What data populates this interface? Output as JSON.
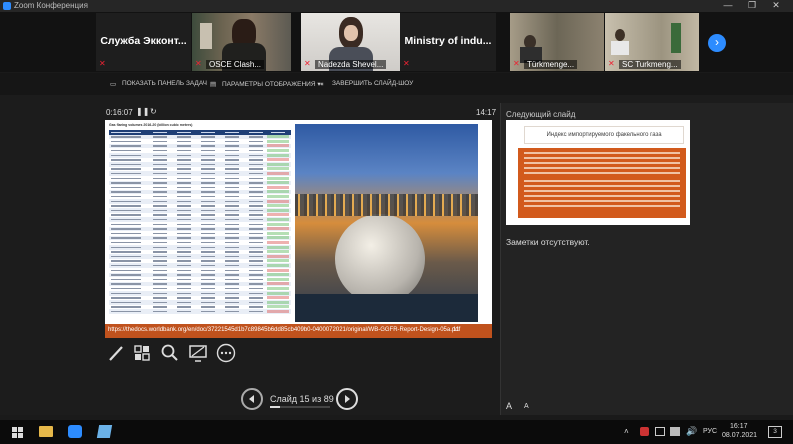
{
  "window": {
    "title": "Zoom Конференция",
    "minimize": "—",
    "restore": "❐",
    "close": "✕"
  },
  "participants": [
    {
      "name": "Служба Экконт...",
      "type": "name-only"
    },
    {
      "name": "OSCE Clash...",
      "type": "video"
    },
    {
      "name": "Nadezda Shevel...",
      "type": "video"
    },
    {
      "name": "Ministry of indu...",
      "type": "name-only"
    },
    {
      "name": "Türkmenge...",
      "type": "video"
    },
    {
      "name": "SC Turkmeng...",
      "type": "video"
    }
  ],
  "presenter_toolbar": {
    "show_taskbar": "ПОКАЗАТЬ ПАНЕЛЬ ЗАДАЧ",
    "display_settings": "ПАРАМЕТРЫ ОТОБРАЖЕНИЯ ▾",
    "end_slideshow": "ЗАВЕРШИТЬ СЛАЙД-ШОУ"
  },
  "timer": {
    "elapsed": "0:16:07",
    "clock": "14:17"
  },
  "slide": {
    "table_title": "Gas flaring volumes 2016-20 (billion cubic meters)",
    "link": "https://thedocs.worldbank.org/en/doc/37221545d1b7c89845b6dd85cb409b0-0400072021/original/WB-GGFR-Report-Design-05a.pdf",
    "page_number": "11"
  },
  "next_slide": {
    "label": "Следующий слайд",
    "title": "Индекс импортируемого факельного газа"
  },
  "notes": {
    "text": "Заметки отсутствуют."
  },
  "font_controls": {
    "increase": "A",
    "decrease": "A"
  },
  "navigation": {
    "counter": "Слайд 15 из 89",
    "current": 15,
    "total": 89
  },
  "taskbar": {
    "lang": "РУС",
    "time": "16:17",
    "date": "08.07.2021",
    "notifications": "3"
  }
}
